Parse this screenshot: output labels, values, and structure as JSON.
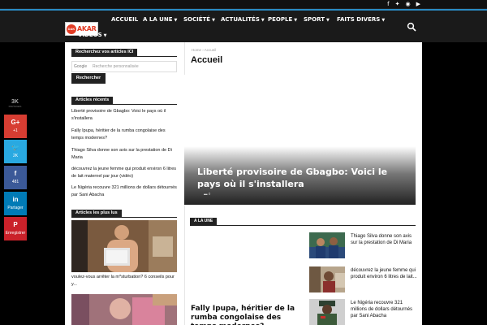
{
  "topbar": {
    "social_icons": [
      "facebook-icon",
      "twitter-icon",
      "rss-icon",
      "youtube-icon"
    ],
    "accent_color": "#2a8bc4"
  },
  "logo": {
    "badge": "DAK",
    "name": "AKAR"
  },
  "nav": {
    "items": [
      {
        "label": "ACCUEIL",
        "dropdown": false
      },
      {
        "label": "A LA UNE",
        "dropdown": true
      },
      {
        "label": "SOCIÉTÉ",
        "dropdown": true
      },
      {
        "label": "ACTUALITÉS",
        "dropdown": true
      },
      {
        "label": "PEOPLE",
        "dropdown": true
      },
      {
        "label": "SPORT",
        "dropdown": true
      },
      {
        "label": "FAITS DIVERS",
        "dropdown": true
      },
      {
        "label": "VIDÉOS",
        "dropdown": true
      }
    ]
  },
  "sidebar": {
    "search_widget": {
      "title": "Recherchez vos articles ICI",
      "google_label": "Google",
      "placeholder": "Recherche personnalisée",
      "button": "Rechercher"
    },
    "recent": {
      "title": "Articles récents",
      "items": [
        "Liberté provisoire de Gbagbo: Voici le pays où il s'installera",
        "Fally Ipupa, héritier de la rumba congolaise des temps modernes?",
        "Thiago Silva donne son avis sur la prestation de Di Maria",
        "découvrez la jeune femme qui produit environ 6 litres de lait maternel par jour (vidéo)",
        "Le Nigéria recouvre 321 millions de dollars détournés par Sani Abacha"
      ]
    },
    "popular": {
      "title": "Articles les plus lus",
      "first_caption": "voulez-vous arrêter la m*sturbation? 6 conseils pour y..."
    }
  },
  "main": {
    "breadcrumb": [
      "Home",
      "Accueil"
    ],
    "breadcrumb_sep": "›",
    "page_title": "Accueil",
    "hero": {
      "title": "Liberté provisoire de Gbagbo: Voici le pays où il s'installera",
      "comments": "0"
    },
    "section_label": "A LA UNE",
    "big_story_title": "Fally Ipupa, héritier de la rumba congolaise des temps modernes?",
    "side_items": [
      "Thiago Silva donne son avis sur la prestation de Di Maria",
      "découvrez la jeune femme qui produit environ 6 litres de lait...",
      "Le Nigéria recouvre 321 millions de dollars détournés par Sani Abacha"
    ]
  },
  "share": {
    "total": "3K",
    "total_label": "PARTAGES",
    "buttons": [
      {
        "network": "google-plus",
        "icon": "G+",
        "count": "+1",
        "color": "#d73d32"
      },
      {
        "network": "twitter",
        "icon": "🐦",
        "count": "2K",
        "color": "#29a9e1"
      },
      {
        "network": "facebook",
        "icon": "f",
        "count": "481",
        "color": "#3b5998"
      },
      {
        "network": "linkedin",
        "icon": "in",
        "count": "Partager",
        "color": "#007bb6"
      },
      {
        "network": "pinterest",
        "icon": "P",
        "count": "Enregistrer",
        "color": "#ca212a"
      }
    ]
  }
}
